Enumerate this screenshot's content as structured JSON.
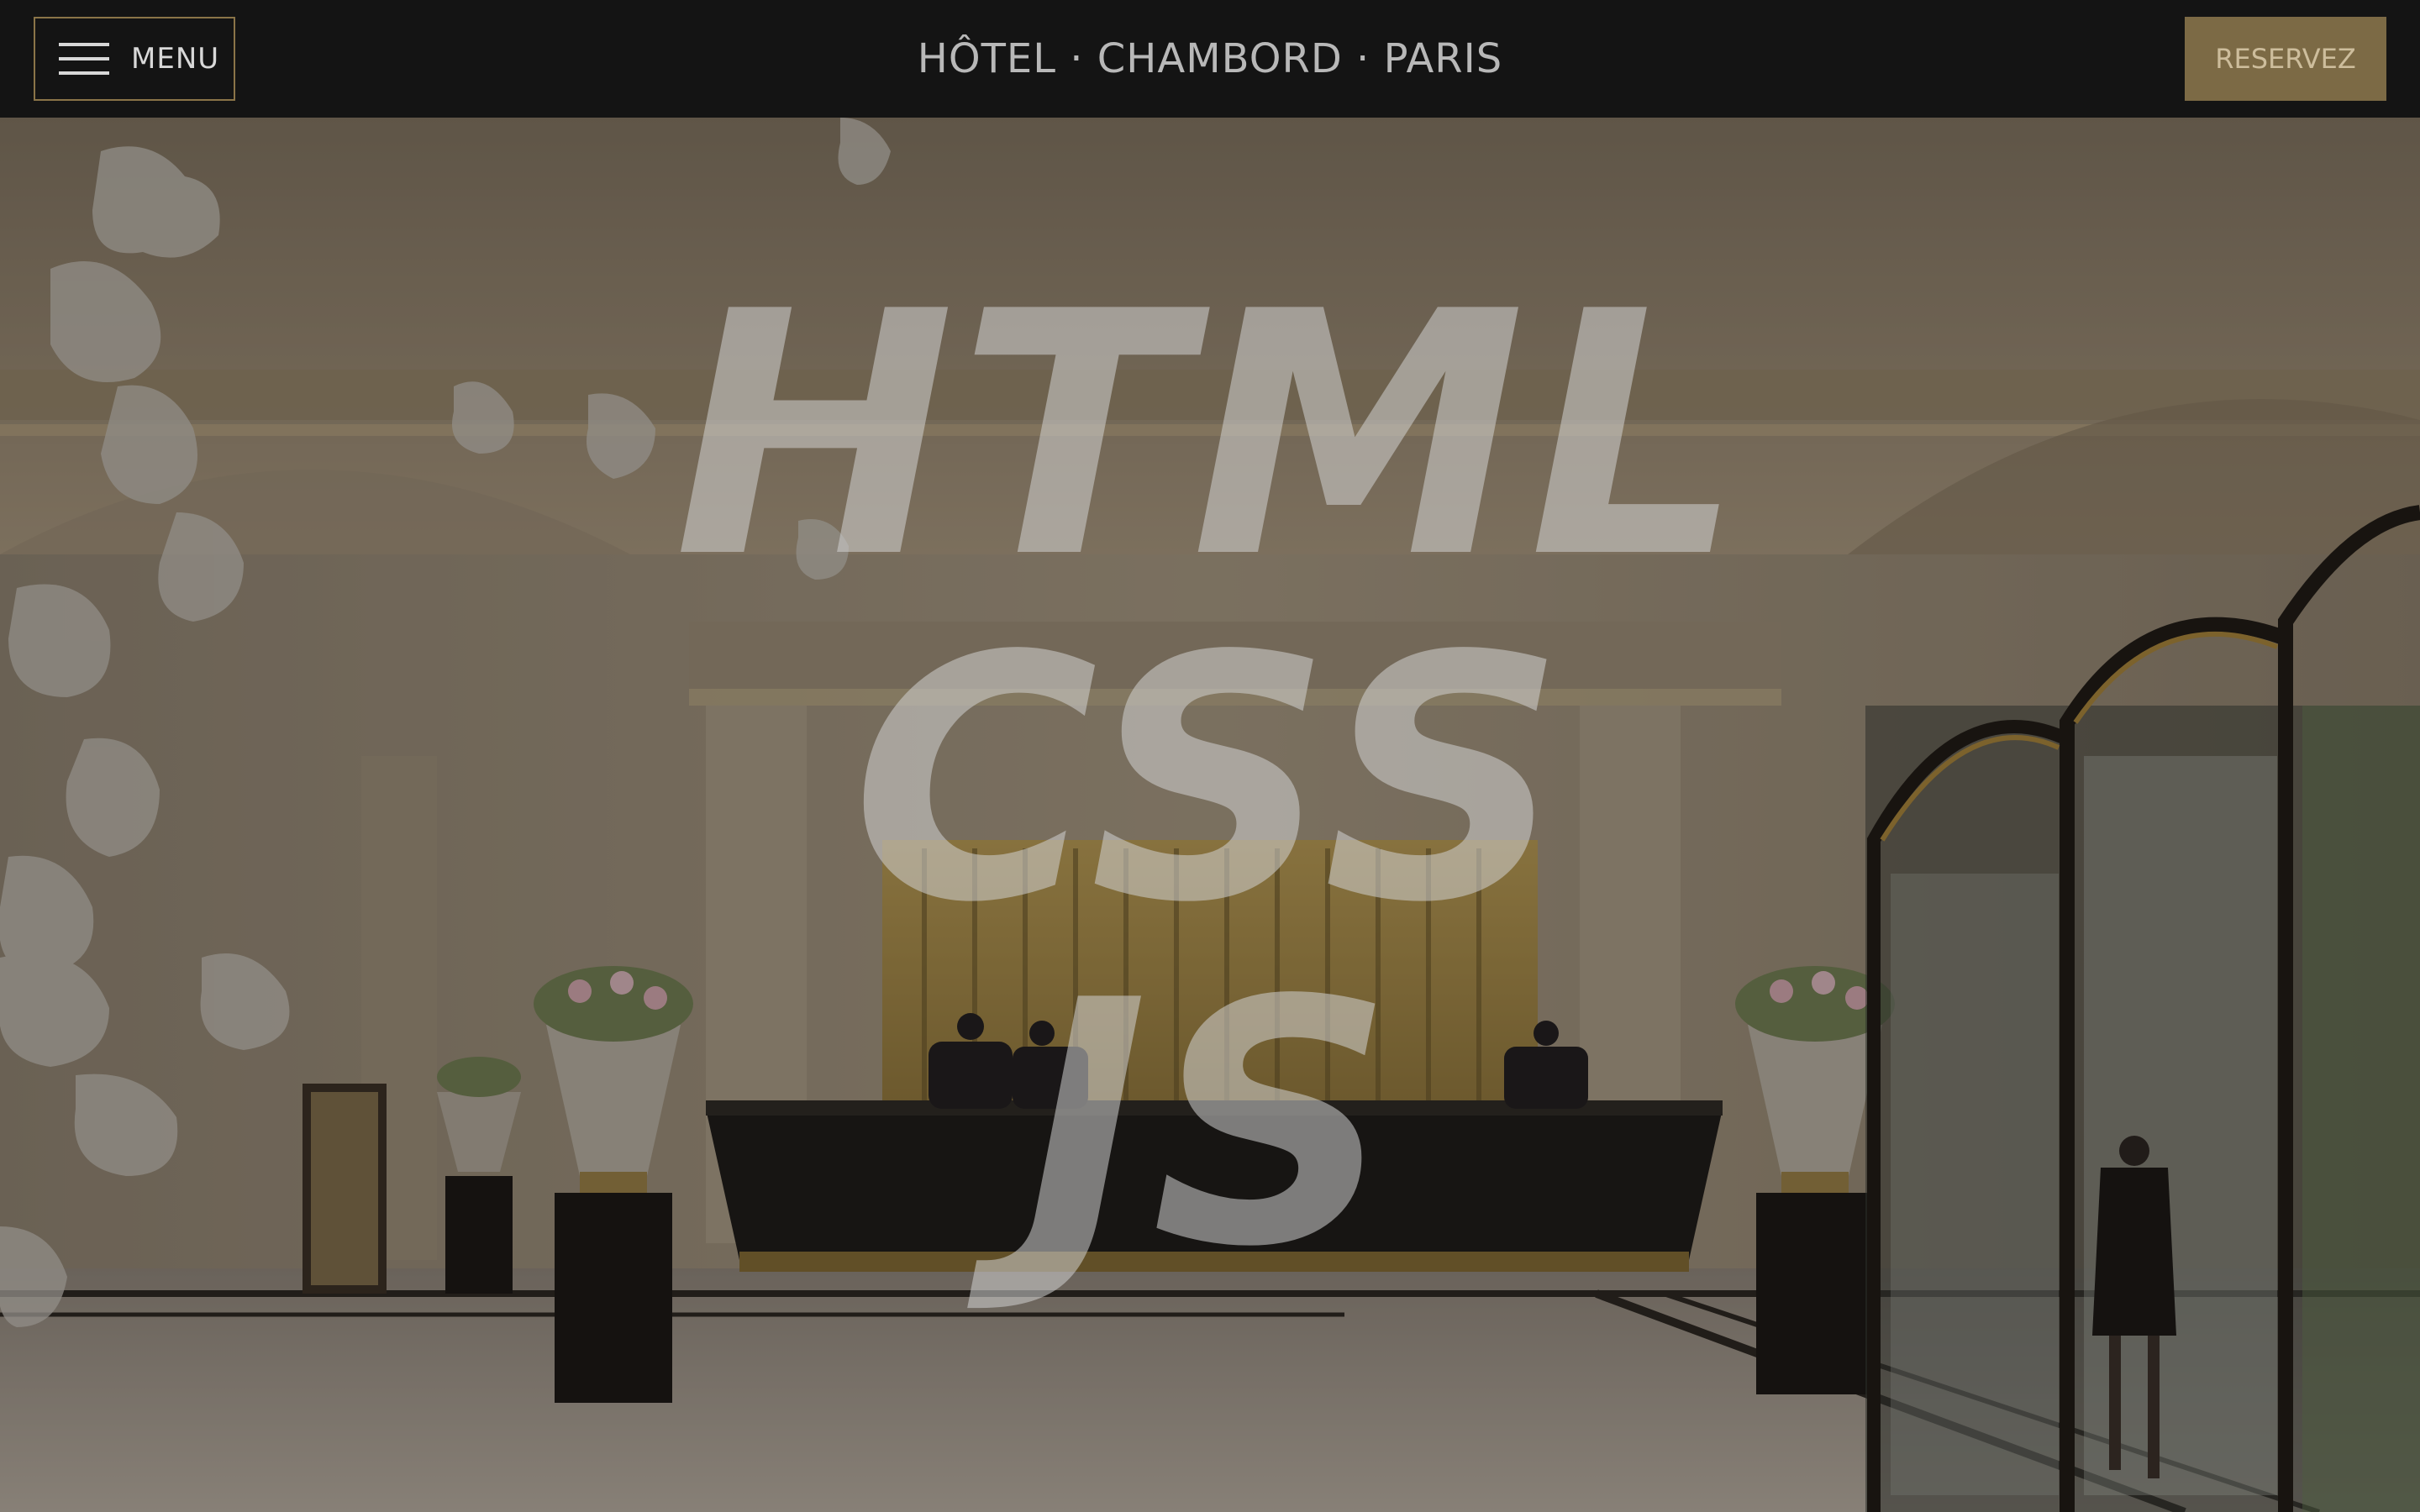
{
  "header": {
    "menu_label": "MENU",
    "brand": "HÔTEL · CHAMBORD · PARIS",
    "reserve_label": "RESERVEZ"
  },
  "hero": {
    "lines": [
      "HTML",
      "CSS",
      "JS"
    ],
    "image_description_icon": "hotel-lobby-photo"
  },
  "colors": {
    "accent_gold": "#7c6a45",
    "border_gold": "#8a7448",
    "bar_background": "#141414"
  }
}
